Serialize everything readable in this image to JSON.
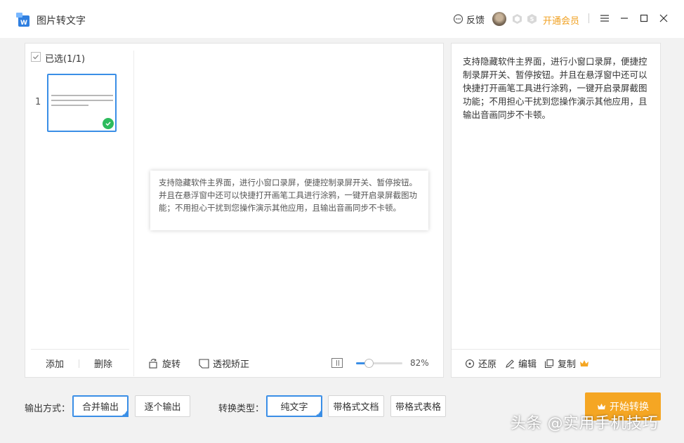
{
  "app": {
    "title": "图片转文字"
  },
  "header": {
    "feedback_label": "反馈",
    "member_label": "开通会员"
  },
  "thumbnails": {
    "selected_label": "已选(1/1)",
    "items": [
      {
        "page": "1"
      }
    ],
    "add_label": "添加",
    "delete_label": "删除"
  },
  "preview": {
    "text": "支持隐藏软件主界面，进行小窗口录屏，便捷控制录屏开关、暂停按钮。并且在悬浮窗中还可以快捷打开画笔工具进行涂鸦，一键开启录屏截图功能；不用担心干扰到您操作演示其他应用，且输出音画同步不卡顿。",
    "rotate_label": "旋转",
    "perspective_label": "透视矫正",
    "zoom": "82%",
    "zoom_fraction": 0.28
  },
  "result": {
    "text": "支持隐藏软件主界面，进行小窗口录屏，便捷控制录屏开关、暂停按钮。并且在悬浮窗中还可以快捷打开画笔工具进行涂鸦，一键开启录屏截图功能；不用担心干扰到您操作演示其他应用，且输出音画同步不卡顿。",
    "restore_label": "还原",
    "edit_label": "编辑",
    "copy_label": "复制"
  },
  "options": {
    "output_label": "输出方式：",
    "output_modes": [
      "合并输出",
      "逐个输出"
    ],
    "output_selected": "合并输出",
    "convert_label": "转换类型：",
    "convert_types": [
      "纯文字",
      "带格式文档",
      "带格式表格"
    ],
    "convert_selected": "纯文字",
    "start_label": "开始转换"
  },
  "watermark": "头条 @实用手机技巧",
  "colors": {
    "accent": "#3a8ee6",
    "start": "#f5a623",
    "member": "#f0a020",
    "check": "#2dbb5d"
  },
  "icons": {
    "app": "image-to-text-logo",
    "feedback": "chat-bubble-icon",
    "rotate": "rotate-icon",
    "perspective": "perspective-icon",
    "fit": "fit-screen-icon",
    "restore": "restore-icon",
    "edit": "pencil-icon",
    "copy": "copy-icon",
    "crown": "crown-icon"
  }
}
